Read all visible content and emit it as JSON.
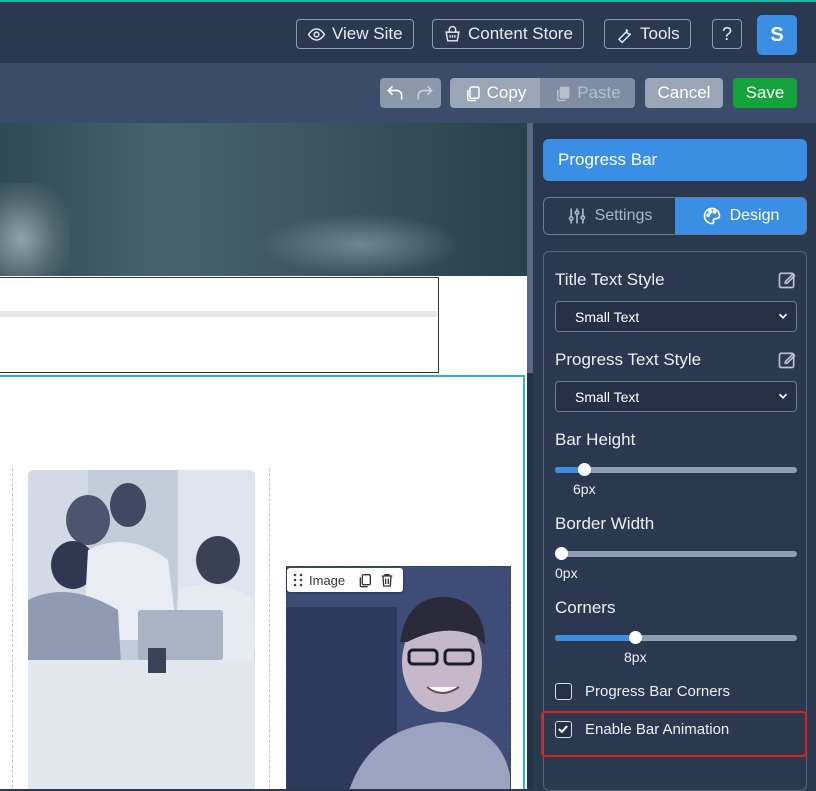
{
  "header": {
    "view_site": "View Site",
    "content_store": "Content Store",
    "tools": "Tools",
    "help": "?",
    "avatar_letter": "S"
  },
  "toolbar": {
    "copy": "Copy",
    "paste": "Paste",
    "cancel": "Cancel",
    "save": "Save"
  },
  "canvas": {
    "image_chip_label": "Image"
  },
  "panel": {
    "title": "Progress Bar",
    "tabs": [
      {
        "label": "Settings",
        "active": false
      },
      {
        "label": "Design",
        "active": true
      }
    ],
    "title_text_style_label": "Title Text Style",
    "title_text_style_value": "Small Text",
    "progress_text_style_label": "Progress Text Style",
    "progress_text_style_value": "Small Text",
    "bar_height_label": "Bar Height",
    "bar_height_value": "6px",
    "bar_height_fraction": 0.12,
    "border_width_label": "Border Width",
    "border_width_value": "0px",
    "border_width_fraction": 0.0,
    "corners_label": "Corners",
    "corners_value": "8px",
    "corners_fraction": 0.33,
    "progress_bar_corners_label": "Progress Bar Corners",
    "progress_bar_corners_checked": false,
    "enable_bar_animation_label": "Enable Bar Animation",
    "enable_bar_animation_checked": true
  },
  "colors": {
    "accent": "#3a8fe4",
    "save": "#14a33a",
    "highlight": "#e02020",
    "section_border": "#29b0d9"
  }
}
